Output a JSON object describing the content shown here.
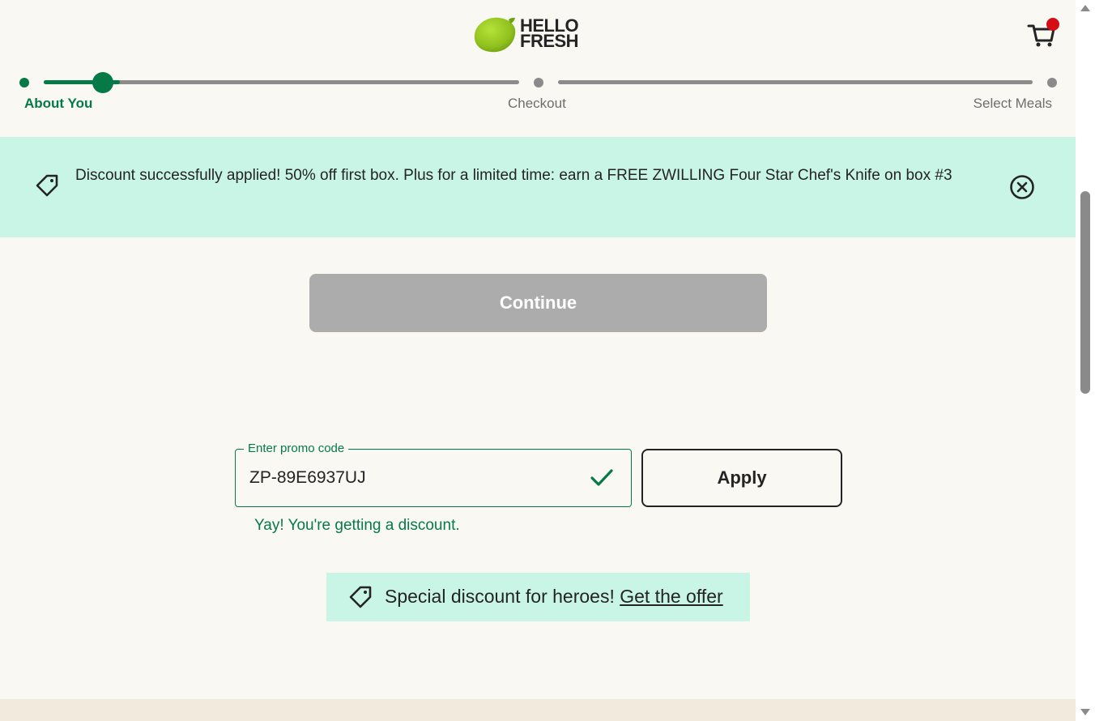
{
  "header": {
    "logo_line1": "HELLO",
    "logo_line2": "FRESH",
    "logo_icon": "lime-icon",
    "cart_icon": "cart-icon",
    "cart_badge_color": "#d40e14"
  },
  "stepper": {
    "progress": 0.16,
    "steps": [
      {
        "label": "About You",
        "state": "current"
      },
      {
        "label": "Checkout",
        "state": "upcoming"
      },
      {
        "label": "Select Meals",
        "state": "upcoming"
      }
    ]
  },
  "banner": {
    "icon": "tag-icon",
    "message": "Discount successfully applied! 50% off first box. Plus for a limited time: earn a FREE ZWILLING Four Star Chef's Knife on box #3",
    "close_icon": "close-circle-icon",
    "bg_color": "#c8f5e6"
  },
  "continue_button": {
    "label": "Continue",
    "disabled": true
  },
  "promo": {
    "legend": "Enter promo code",
    "value": "ZP-89E6937UJ",
    "status_icon": "check-icon",
    "apply_label": "Apply",
    "success_message": "Yay! You're getting a discount."
  },
  "heroes": {
    "icon": "tag-icon",
    "text": "Special discount for heroes!",
    "link": "Get the offer"
  },
  "colors": {
    "brand_green": "#067a46",
    "lime": "#91c11e",
    "background": "#f9f8f3",
    "mint": "#c8f5e6"
  }
}
